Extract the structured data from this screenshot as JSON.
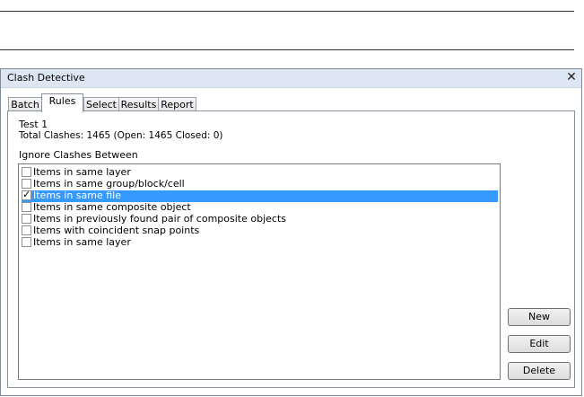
{
  "window": {
    "title": "Clash Detective",
    "close_glyph": "✕"
  },
  "tabs": [
    {
      "label": "Batch",
      "active": false
    },
    {
      "label": "Rules",
      "active": true
    },
    {
      "label": "Select",
      "active": false
    },
    {
      "label": "Results",
      "active": false
    },
    {
      "label": "Report",
      "active": false
    }
  ],
  "test": {
    "name": "Test 1",
    "summary": "Total Clashes: 1465 (Open: 1465 Closed: 0)"
  },
  "ignore_label": "Ignore Clashes Between",
  "rules": [
    {
      "label": "Items in same layer",
      "checked": false,
      "selected": false
    },
    {
      "label": "Items in same group/block/cell",
      "checked": false,
      "selected": false
    },
    {
      "label": "Items in same file",
      "checked": true,
      "selected": true
    },
    {
      "label": "Items in same composite object",
      "checked": false,
      "selected": false
    },
    {
      "label": "Items in previously found pair of composite objects",
      "checked": false,
      "selected": false
    },
    {
      "label": "Items with coincident snap points",
      "checked": false,
      "selected": false
    },
    {
      "label": "Items in same layer",
      "checked": false,
      "selected": false
    }
  ],
  "buttons": {
    "new_label": "New",
    "edit_label": "Edit",
    "delete_label": "Delete"
  },
  "check_glyph": "✓",
  "colors": {
    "selection": "#3399ff",
    "titlebar": "#dde7f3"
  }
}
